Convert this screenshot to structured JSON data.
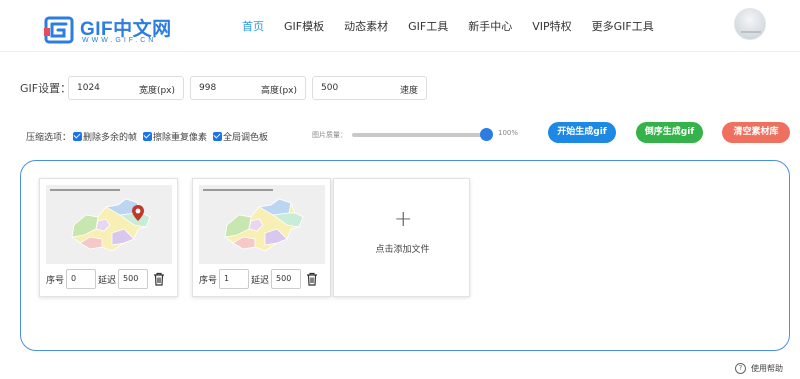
{
  "header": {
    "logo_text": "GIF中文网",
    "logo_sub": "WWW.GIF.CN",
    "nav": [
      {
        "label": "首页",
        "active": true
      },
      {
        "label": "GIF模板",
        "active": false
      },
      {
        "label": "动态素材",
        "active": false
      },
      {
        "label": "GIF工具",
        "active": false
      },
      {
        "label": "新手中心",
        "active": false
      },
      {
        "label": "VIP特权",
        "active": false
      },
      {
        "label": "更多GIF工具",
        "active": false
      }
    ]
  },
  "settings": {
    "label": "GIF设置：",
    "width": {
      "value": "1024",
      "unit": "宽度(px)"
    },
    "height": {
      "value": "998",
      "unit": "高度(px)"
    },
    "speed": {
      "value": "500",
      "unit": "速度"
    }
  },
  "options": {
    "label": "压缩选项：",
    "checkboxes": [
      {
        "label": "删除多余的帧",
        "checked": true
      },
      {
        "label": "擦除重复像素",
        "checked": true
      },
      {
        "label": "全局调色板",
        "checked": true
      }
    ],
    "quality_label": "图片质量：",
    "quality_value": "100%",
    "quality_level": 1.0
  },
  "buttons": {
    "start": "开始生成gif",
    "reverse": "倒序生成gif",
    "clear": "清空素材库"
  },
  "frames": [
    {
      "index_label": "序号",
      "index": "0",
      "delay_label": "延迟",
      "delay": "500"
    },
    {
      "index_label": "序号",
      "index": "1",
      "delay_label": "延迟",
      "delay": "500"
    }
  ],
  "add_file": {
    "label": "点击添加文件"
  },
  "help": {
    "label": "使用帮助"
  },
  "colors": {
    "accent": "#2b7de1",
    "start": "#1e88e5",
    "reverse": "#35b34a",
    "clear": "#f07060"
  }
}
